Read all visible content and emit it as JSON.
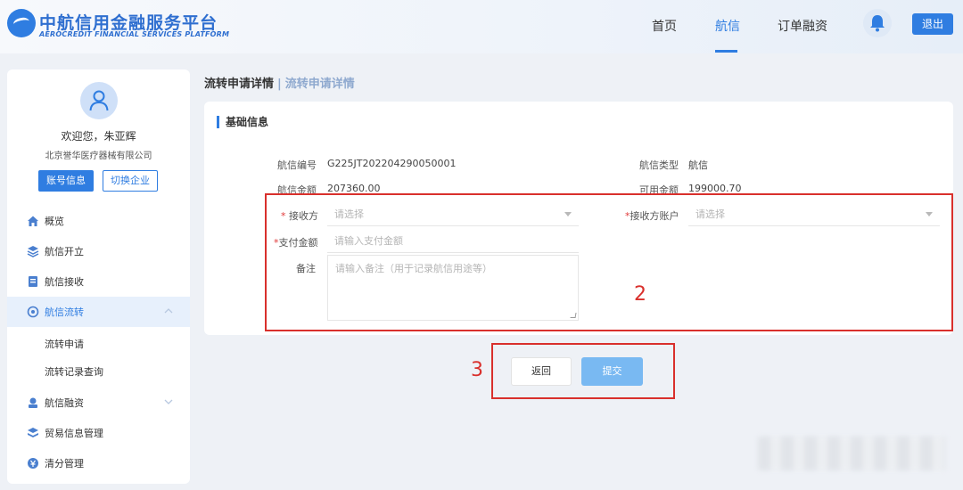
{
  "header": {
    "brand_cn": "中航信用金融服务平台",
    "brand_en": "AEROCREDIT FINANCIAL SERVICES PLATFORM",
    "nav": [
      {
        "label": "首页",
        "active": false
      },
      {
        "label": "航信",
        "active": true
      },
      {
        "label": "订单融资",
        "active": false
      }
    ],
    "logout_label": "退出",
    "accent_color": "#2f7de1"
  },
  "sidebar": {
    "welcome": "欢迎您，朱亚辉",
    "company": "北京誉华医疗器械有限公司",
    "account_button": "账号信息",
    "switch_button": "切换企业",
    "items": [
      {
        "label": "概览",
        "icon": "home-icon"
      },
      {
        "label": "航信开立",
        "icon": "layers-icon"
      },
      {
        "label": "航信接收",
        "icon": "receive-icon"
      },
      {
        "label": "航信流转",
        "icon": "flow-icon",
        "active": true,
        "expanded": true
      },
      {
        "label": "航信融资",
        "icon": "finance-icon"
      },
      {
        "label": "贸易信息管理",
        "icon": "stack-icon"
      },
      {
        "label": "清分管理",
        "icon": "clear-icon"
      }
    ],
    "sub_items": [
      "流转申请",
      "流转记录查询"
    ]
  },
  "main": {
    "breadcrumb_current": "流转申请详情",
    "breadcrumb_separator": "|",
    "breadcrumb_sub": "流转申请详情",
    "section_title": "基础信息",
    "fields": {
      "credit_no_label": "航信编号",
      "credit_no_value": "G225JT202204290050001",
      "credit_type_label": "航信类型",
      "credit_type_value": "航信",
      "credit_amount_label": "航信金额",
      "credit_amount_value": "207360.00",
      "available_amount_label": "可用金额",
      "available_amount_value": "199000.70"
    },
    "form": {
      "receiver_label": "接收方",
      "receiver_placeholder": "请选择",
      "receiver_account_label": "接收方账户",
      "receiver_account_placeholder": "请选择",
      "pay_amount_label": "支付金额",
      "pay_amount_placeholder": "请输入支付金额",
      "remark_label": "备注",
      "remark_placeholder": "请输入备注（用于记录航信用途等）",
      "required_mark": "*"
    },
    "annotation_2": "2",
    "annotation_3": "3",
    "back_button": "返回",
    "submit_button": "提交"
  }
}
